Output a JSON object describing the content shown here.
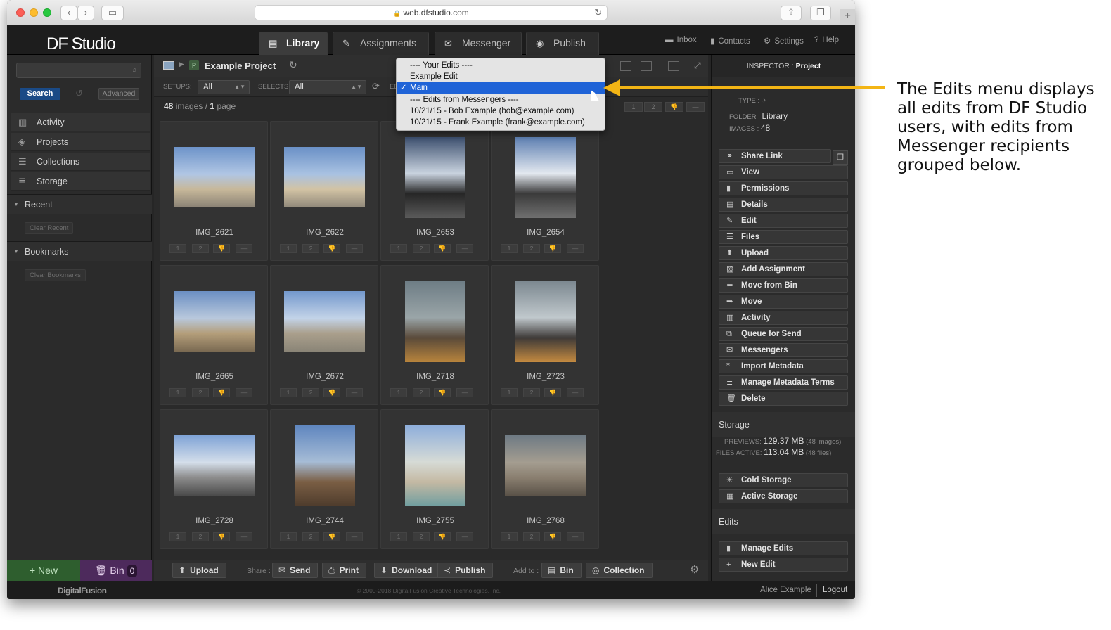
{
  "browser": {
    "url": "web.dfstudio.com"
  },
  "app": {
    "logo": "DF Studio",
    "tabs": [
      {
        "label": "Library",
        "icon": "library-icon"
      },
      {
        "label": "Assignments",
        "icon": "assignments-icon"
      },
      {
        "label": "Messenger",
        "icon": "messenger-icon"
      },
      {
        "label": "Publish",
        "icon": "publish-icon"
      }
    ],
    "header_links": [
      {
        "label": "Inbox",
        "icon": "inbox-icon"
      },
      {
        "label": "Contacts",
        "icon": "contacts-icon"
      },
      {
        "label": "Settings",
        "icon": "gear-icon"
      },
      {
        "label": "Help",
        "icon": "help-icon"
      }
    ]
  },
  "sidebar": {
    "search_label": "Search",
    "advanced_label": "Advanced",
    "nav": [
      {
        "label": "Activity",
        "icon": "activity-icon"
      },
      {
        "label": "Projects",
        "icon": "projects-icon"
      },
      {
        "label": "Collections",
        "icon": "collections-icon"
      },
      {
        "label": "Storage",
        "icon": "storage-icon"
      }
    ],
    "recent_label": "Recent",
    "clear_recent": "Clear Recent",
    "bookmarks_label": "Bookmarks",
    "clear_bookmarks": "Clear Bookmarks",
    "new_label": "+ New",
    "bin_label": "Bin",
    "bin_count": "0"
  },
  "center": {
    "project_badge": "P",
    "project_title": "Example Project",
    "setups_label": "SETUPS:",
    "setups_value": "All",
    "selects_label": "SELECTS:",
    "selects_value": "All",
    "edits_label": "EDIT",
    "image_count": "48",
    "images_word": "images",
    "page_count": "1",
    "page_word": "page",
    "rating_buttons": [
      "1",
      "2",
      "👎",
      "—"
    ],
    "images": [
      {
        "name": "IMG_2621"
      },
      {
        "name": "IMG_2622"
      },
      {
        "name": "IMG_2653"
      },
      {
        "name": "IMG_2654"
      },
      {
        "name": "IMG_2665"
      },
      {
        "name": "IMG_2672"
      },
      {
        "name": "IMG_2718"
      },
      {
        "name": "IMG_2723"
      },
      {
        "name": "IMG_2728"
      },
      {
        "name": "IMG_2744"
      },
      {
        "name": "IMG_2755"
      },
      {
        "name": "IMG_2768"
      }
    ],
    "bottom": {
      "upload": "Upload",
      "share_label": "Share :",
      "send": "Send",
      "print": "Print",
      "download": "Download",
      "publish": "Publish",
      "add_to_label": "Add to :",
      "bin": "Bin",
      "collection": "Collection"
    }
  },
  "edits_menu": {
    "header_your": "---- Your Edits ----",
    "item_example": "Example Edit",
    "item_main": "Main",
    "check": "✓",
    "header_messengers": "---- Edits from Messengers ----",
    "item_bob": "10/21/15 - Bob Example (bob@example.com)",
    "item_frank": "10/21/15 - Frank Example (frank@example.com)"
  },
  "inspector": {
    "title_prefix": "INSPECTOR :",
    "title": "Project",
    "type_label": "TYPE :",
    "folder_label": "FOLDER :",
    "folder_value": "Library",
    "images_label": "IMAGES :",
    "images_value": "48",
    "actions": [
      {
        "label": "Share Link",
        "icon": "link-icon"
      },
      {
        "label": "View",
        "icon": "view-icon"
      },
      {
        "label": "Permissions",
        "icon": "lock-icon"
      },
      {
        "label": "Details",
        "icon": "details-icon"
      },
      {
        "label": "Edit",
        "icon": "pencil-icon"
      },
      {
        "label": "Files",
        "icon": "files-icon"
      },
      {
        "label": "Upload",
        "icon": "upload-icon"
      },
      {
        "label": "Add Assignment",
        "icon": "assignment-icon"
      },
      {
        "label": "Move from Bin",
        "icon": "arrow-left-icon"
      },
      {
        "label": "Move",
        "icon": "arrow-right-icon"
      },
      {
        "label": "Activity",
        "icon": "activity-icon"
      },
      {
        "label": "Queue for Send",
        "icon": "queue-icon"
      },
      {
        "label": "Messengers",
        "icon": "mail-icon"
      },
      {
        "label": "Import Metadata",
        "icon": "import-icon"
      },
      {
        "label": "Manage Metadata Terms",
        "icon": "list-icon"
      },
      {
        "label": "Delete",
        "icon": "trash-icon"
      }
    ],
    "storage_label": "Storage",
    "previews_label": "PREVIEWS:",
    "previews_value": "129.37 MB",
    "previews_note": "(48 images)",
    "files_label": "FILES ACTIVE:",
    "files_value": "113.04 MB",
    "files_note": "(48 files)",
    "cold_storage": "Cold Storage",
    "active_storage": "Active Storage",
    "edits_label": "Edits",
    "manage_edits": "Manage Edits",
    "new_edit": "New Edit"
  },
  "footer": {
    "logo": "DigitalFusion",
    "copyright": "© 2000-2018 DigitalFusion Creative Technologies, Inc.",
    "user": "Alice Example",
    "logout": "Logout"
  },
  "callout": {
    "text": "The Edits menu displays all edits from DF Studio users, with edits from Messenger recipients grouped below.",
    "color": "#f3b515"
  }
}
